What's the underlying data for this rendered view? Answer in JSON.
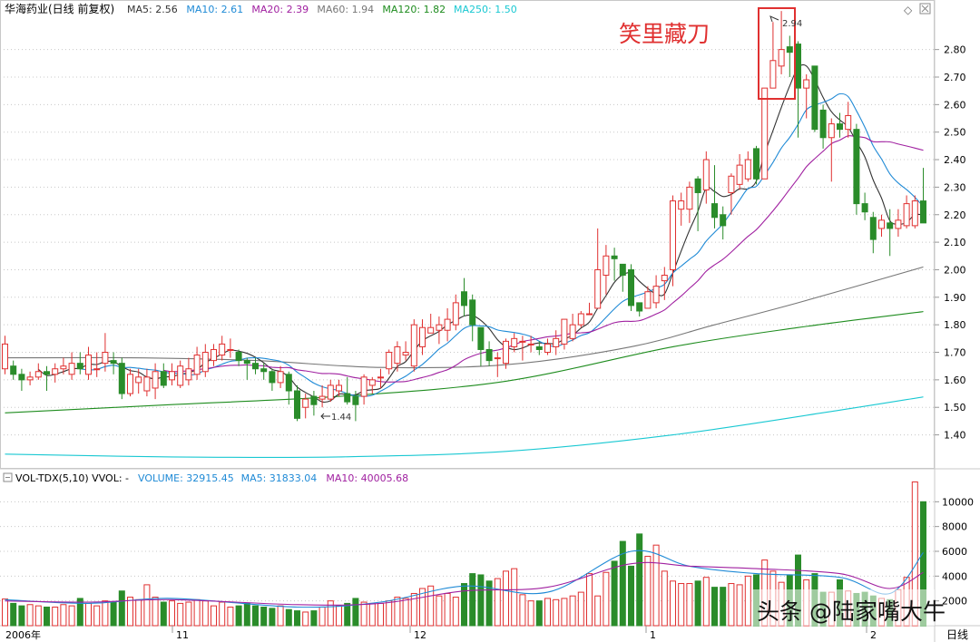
{
  "header": {
    "title": "华海药业(日线 前复权)",
    "ma_legend": [
      {
        "label": "MA5: 2.56",
        "color": "#333333"
      },
      {
        "label": "MA10: 2.61",
        "color": "#1f8ad6"
      },
      {
        "label": "MA20: 2.39",
        "color": "#a020a0"
      },
      {
        "label": "MA60: 1.94",
        "color": "#777777"
      },
      {
        "label": "MA120: 1.82",
        "color": "#1e8c1e"
      },
      {
        "label": "MA250: 1.50",
        "color": "#19c8d2"
      }
    ]
  },
  "annotation": {
    "text": "笑里藏刀",
    "color": "#e03030"
  },
  "price_labels": {
    "high": "2.94",
    "low": "1.44"
  },
  "volume_header": {
    "label": "VOL-TDX(5,10) VVOL: -",
    "items": [
      {
        "label": "VOLUME: 32915.45",
        "color": "#1f8ad6"
      },
      {
        "label": "MA5: 31833.04",
        "color": "#1f8ad6"
      },
      {
        "label": "MA10: 40005.68",
        "color": "#a020a0"
      }
    ]
  },
  "x_axis_labels": [
    "2006年",
    "11",
    "12",
    "1",
    "2"
  ],
  "period_label": "日线",
  "watermark": "头条 @陆家嘴大牛",
  "colors": {
    "up": "#e03030",
    "down": "#2a8c2a",
    "grid": "#c8c8c8",
    "accent_box": "#e03030"
  },
  "chart_data": [
    {
      "type": "candlestick",
      "name": "price",
      "y_ticks": [
        1.4,
        1.5,
        1.6,
        1.7,
        1.8,
        1.9,
        2.0,
        2.1,
        2.2,
        2.3,
        2.4,
        2.5,
        2.6,
        2.7,
        2.8
      ],
      "ylim": [
        1.28,
        2.98
      ],
      "candles": [
        [
          1.64,
          1.73,
          1.76,
          1.62
        ],
        [
          1.65,
          1.62,
          1.67,
          1.6
        ],
        [
          1.62,
          1.6,
          1.64,
          1.56
        ],
        [
          1.6,
          1.61,
          1.63,
          1.58
        ],
        [
          1.61,
          1.63,
          1.66,
          1.6
        ],
        [
          1.63,
          1.62,
          1.65,
          1.56
        ],
        [
          1.62,
          1.64,
          1.66,
          1.59
        ],
        [
          1.64,
          1.65,
          1.68,
          1.62
        ],
        [
          1.62,
          1.66,
          1.7,
          1.6
        ],
        [
          1.66,
          1.64,
          1.7,
          1.62
        ],
        [
          1.62,
          1.69,
          1.72,
          1.6
        ],
        [
          1.64,
          1.64,
          1.7,
          1.61
        ],
        [
          1.66,
          1.7,
          1.77,
          1.63
        ],
        [
          1.67,
          1.66,
          1.7,
          1.62
        ],
        [
          1.66,
          1.55,
          1.68,
          1.53
        ],
        [
          1.55,
          1.62,
          1.64,
          1.54
        ],
        [
          1.59,
          1.61,
          1.64,
          1.55
        ],
        [
          1.56,
          1.61,
          1.64,
          1.54
        ],
        [
          1.57,
          1.63,
          1.66,
          1.53
        ],
        [
          1.63,
          1.58,
          1.66,
          1.57
        ],
        [
          1.6,
          1.63,
          1.66,
          1.58
        ],
        [
          1.58,
          1.65,
          1.67,
          1.57
        ],
        [
          1.6,
          1.64,
          1.68,
          1.58
        ],
        [
          1.62,
          1.69,
          1.72,
          1.6
        ],
        [
          1.63,
          1.7,
          1.73,
          1.61
        ],
        [
          1.67,
          1.71,
          1.73,
          1.65
        ],
        [
          1.69,
          1.73,
          1.76,
          1.67
        ],
        [
          1.71,
          1.71,
          1.75,
          1.68
        ],
        [
          1.7,
          1.67,
          1.71,
          1.65
        ],
        [
          1.67,
          1.66,
          1.68,
          1.6
        ],
        [
          1.66,
          1.64,
          1.68,
          1.62
        ],
        [
          1.64,
          1.63,
          1.66,
          1.6
        ],
        [
          1.63,
          1.59,
          1.64,
          1.56
        ],
        [
          1.59,
          1.63,
          1.65,
          1.57
        ],
        [
          1.62,
          1.56,
          1.63,
          1.51
        ],
        [
          1.56,
          1.46,
          1.58,
          1.45
        ],
        [
          1.5,
          1.53,
          1.55,
          1.46
        ],
        [
          1.54,
          1.51,
          1.56,
          1.47
        ],
        [
          1.53,
          1.54,
          1.58,
          1.5
        ],
        [
          1.53,
          1.58,
          1.6,
          1.52
        ],
        [
          1.56,
          1.58,
          1.6,
          1.54
        ],
        [
          1.55,
          1.52,
          1.61,
          1.51
        ],
        [
          1.54,
          1.51,
          1.56,
          1.45
        ],
        [
          1.54,
          1.61,
          1.62,
          1.51
        ],
        [
          1.58,
          1.6,
          1.61,
          1.55
        ],
        [
          1.61,
          1.61,
          1.64,
          1.57
        ],
        [
          1.64,
          1.7,
          1.71,
          1.62
        ],
        [
          1.66,
          1.72,
          1.74,
          1.63
        ],
        [
          1.69,
          1.7,
          1.74,
          1.67
        ],
        [
          1.65,
          1.8,
          1.82,
          1.63
        ],
        [
          1.72,
          1.79,
          1.82,
          1.69
        ],
        [
          1.77,
          1.79,
          1.84,
          1.77
        ],
        [
          1.78,
          1.8,
          1.83,
          1.73
        ],
        [
          1.78,
          1.82,
          1.86,
          1.74
        ],
        [
          1.8,
          1.88,
          1.91,
          1.78
        ],
        [
          1.92,
          1.87,
          1.97,
          1.83
        ],
        [
          1.89,
          1.8,
          1.91,
          1.74
        ],
        [
          1.79,
          1.71,
          1.79,
          1.65
        ],
        [
          1.71,
          1.67,
          1.74,
          1.65
        ],
        [
          1.68,
          1.68,
          1.7,
          1.61
        ],
        [
          1.66,
          1.74,
          1.75,
          1.64
        ],
        [
          1.72,
          1.75,
          1.77,
          1.7
        ],
        [
          1.74,
          1.74,
          1.76,
          1.67
        ],
        [
          1.73,
          1.73,
          1.76,
          1.7
        ],
        [
          1.72,
          1.71,
          1.74,
          1.69
        ],
        [
          1.7,
          1.73,
          1.75,
          1.69
        ],
        [
          1.72,
          1.75,
          1.78,
          1.69
        ],
        [
          1.73,
          1.82,
          1.82,
          1.71
        ],
        [
          1.75,
          1.8,
          1.84,
          1.74
        ],
        [
          1.8,
          1.84,
          1.85,
          1.79
        ],
        [
          1.84,
          1.84,
          1.88,
          1.84
        ],
        [
          1.86,
          2.0,
          2.15,
          1.86
        ],
        [
          1.98,
          2.05,
          2.09,
          1.91
        ],
        [
          2.05,
          2.04,
          2.08,
          1.96
        ],
        [
          2.02,
          1.98,
          2.01,
          1.92
        ],
        [
          2.0,
          1.87,
          2.02,
          1.85
        ],
        [
          1.88,
          1.85,
          1.88,
          1.83
        ],
        [
          1.86,
          1.92,
          1.94,
          1.86
        ],
        [
          1.88,
          1.94,
          1.98,
          1.86
        ],
        [
          1.96,
          1.98,
          2.01,
          1.89
        ],
        [
          2.0,
          2.25,
          2.27,
          1.94
        ],
        [
          2.22,
          2.25,
          2.28,
          2.16
        ],
        [
          2.22,
          2.3,
          2.32,
          2.17
        ],
        [
          2.33,
          2.28,
          2.34,
          2.14
        ],
        [
          2.29,
          2.4,
          2.43,
          2.24
        ],
        [
          2.24,
          2.19,
          2.38,
          2.15
        ],
        [
          2.2,
          2.16,
          2.23,
          2.11
        ],
        [
          2.28,
          2.34,
          2.35,
          2.2
        ],
        [
          2.31,
          2.38,
          2.42,
          2.29
        ],
        [
          2.33,
          2.4,
          2.43,
          2.32
        ],
        [
          2.44,
          2.33,
          2.45,
          2.31
        ],
        [
          2.33,
          2.66,
          2.66,
          2.33
        ],
        [
          2.66,
          2.76,
          2.9,
          2.66
        ],
        [
          2.74,
          2.8,
          2.94,
          2.71
        ],
        [
          2.81,
          2.79,
          2.85,
          2.7
        ],
        [
          2.82,
          2.66,
          2.83,
          2.48
        ],
        [
          2.66,
          2.69,
          2.71,
          2.55
        ],
        [
          2.74,
          2.51,
          2.74,
          2.5
        ],
        [
          2.58,
          2.48,
          2.6,
          2.44
        ],
        [
          2.48,
          2.53,
          2.55,
          2.32
        ],
        [
          2.53,
          2.51,
          2.57,
          2.48
        ],
        [
          2.51,
          2.56,
          2.61,
          2.48
        ],
        [
          2.51,
          2.24,
          2.53,
          2.2
        ],
        [
          2.24,
          2.21,
          2.28,
          2.18
        ],
        [
          2.19,
          2.11,
          2.21,
          2.06
        ],
        [
          2.15,
          2.18,
          2.2,
          2.12
        ],
        [
          2.17,
          2.15,
          2.22,
          2.05
        ],
        [
          2.15,
          2.18,
          2.22,
          2.12
        ],
        [
          2.16,
          2.24,
          2.27,
          2.15
        ],
        [
          2.16,
          2.25,
          2.27,
          2.15
        ],
        [
          2.25,
          2.17,
          2.37,
          2.17
        ]
      ],
      "moving_averages": [
        {
          "name": "MA250",
          "color": "#19c8d2",
          "knots": [
            [
              0,
              1.33
            ],
            [
              20,
              1.32
            ],
            [
              40,
              1.32
            ],
            [
              60,
              1.34
            ],
            [
              80,
              1.4
            ],
            [
              100,
              1.49
            ],
            [
              110,
              1.538
            ]
          ]
        },
        {
          "name": "MA120",
          "color": "#1e8c1e",
          "knots": [
            [
              0,
              1.48
            ],
            [
              20,
              1.51
            ],
            [
              40,
              1.54
            ],
            [
              60,
              1.595
            ],
            [
              80,
              1.72
            ],
            [
              95,
              1.79
            ],
            [
              110,
              1.848
            ]
          ]
        },
        {
          "name": "MA60",
          "color": "#777777",
          "knots": [
            [
              0,
              1.68
            ],
            [
              15,
              1.68
            ],
            [
              30,
              1.67
            ],
            [
              45,
              1.645
            ],
            [
              60,
              1.655
            ],
            [
              75,
              1.72
            ],
            [
              85,
              1.8
            ],
            [
              95,
              1.88
            ],
            [
              110,
              2.01
            ]
          ]
        }
      ]
    },
    {
      "type": "bar",
      "name": "volume",
      "y_ticks": [
        2000,
        4000,
        6000,
        8000,
        10000
      ],
      "ylim": [
        0,
        12000
      ],
      "values": [
        2150,
        1800,
        1600,
        1700,
        1600,
        1500,
        1500,
        1700,
        1600,
        2200,
        1800,
        1600,
        2000,
        1900,
        2800,
        2300,
        2100,
        3300,
        2300,
        1900,
        2000,
        1800,
        1900,
        2100,
        2000,
        1600,
        1900,
        1500,
        1600,
        1800,
        1600,
        1500,
        1400,
        1600,
        1300,
        1200,
        1100,
        1200,
        1500,
        2000,
        1600,
        1800,
        2200,
        1900,
        1800,
        1800,
        2000,
        2300,
        2200,
        2600,
        3000,
        3200,
        2400,
        2600,
        2300,
        3400,
        4200,
        4100,
        3600,
        3800,
        4400,
        4600,
        2500,
        2000,
        2000,
        2200,
        2100,
        2200,
        2400,
        2700,
        4200,
        2400,
        4300,
        5200,
        6800,
        4800,
        7400,
        5600,
        6500,
        4400,
        3600,
        3400,
        3400,
        3600,
        3900,
        3100,
        3100,
        3400,
        3300,
        4000,
        4100,
        5300,
        4400,
        3500,
        4100,
        5700,
        3700,
        4200,
        2700,
        2700,
        3700,
        2800,
        2600,
        2700,
        2400,
        2200,
        2100,
        2900,
        3900,
        11600,
        10000
      ],
      "moving_averages": [
        {
          "name": "MA5",
          "color": "#1f8ad6",
          "knots": [
            [
              0,
              2100
            ],
            [
              10,
              1800
            ],
            [
              20,
              2200
            ],
            [
              35,
              1500
            ],
            [
              45,
              1900
            ],
            [
              55,
              3200
            ],
            [
              65,
              2700
            ],
            [
              75,
              6000
            ],
            [
              82,
              4800
            ],
            [
              90,
              4200
            ],
            [
              100,
              3900
            ],
            [
              106,
              2600
            ],
            [
              110,
              5900
            ]
          ]
        },
        {
          "name": "MA10",
          "color": "#a020a0",
          "knots": [
            [
              0,
              2000
            ],
            [
              10,
              1900
            ],
            [
              20,
              2100
            ],
            [
              35,
              1700
            ],
            [
              45,
              1800
            ],
            [
              55,
              2800
            ],
            [
              65,
              3100
            ],
            [
              75,
              5000
            ],
            [
              82,
              4800
            ],
            [
              90,
              4600
            ],
            [
              100,
              4200
            ],
            [
              106,
              3000
            ],
            [
              110,
              4300
            ]
          ]
        }
      ]
    }
  ]
}
